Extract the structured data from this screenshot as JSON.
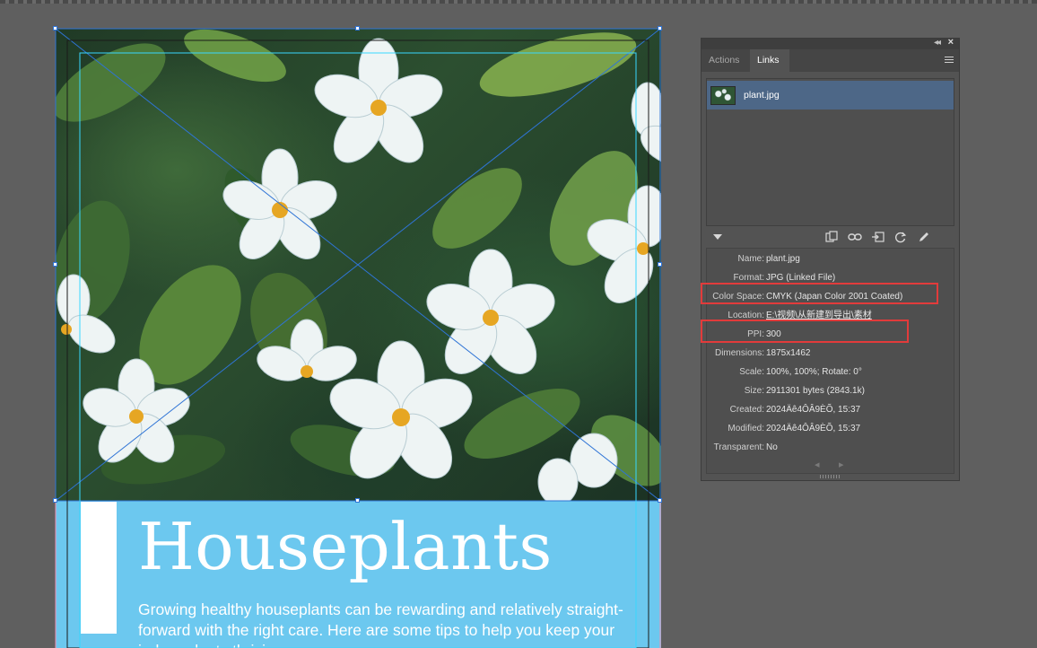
{
  "document": {
    "headline": "Houseplants",
    "body": "Growing healthy houseplants can be rewarding and relatively straight-forward with the right care. Here are some tips to help you keep your indoor plants thriving:"
  },
  "panel": {
    "tabs": [
      {
        "label": "Actions",
        "active": false
      },
      {
        "label": "Links",
        "active": true
      }
    ],
    "links": [
      {
        "name": "plant.jpg",
        "selected": true
      }
    ],
    "info": [
      {
        "label": "Name:",
        "value": "plant.jpg"
      },
      {
        "label": "Format:",
        "value": "JPG (Linked File)"
      },
      {
        "label": "Color Space:",
        "value": "CMYK (Japan Color 2001 Coated)"
      },
      {
        "label": "Location:",
        "value": "E:\\视频\\从新建到导出\\素材"
      },
      {
        "label": "PPI:",
        "value": "300"
      },
      {
        "label": "Dimensions:",
        "value": "1875x1462"
      },
      {
        "label": "Scale:",
        "value": "100%, 100%; Rotate: 0°"
      },
      {
        "label": "Size:",
        "value": "2911301 bytes (2843.1k)"
      },
      {
        "label": "Created:",
        "value": "2024Äê4ÔÂ9ÈÕ, 15:37"
      },
      {
        "label": "Modified:",
        "value": "2024Äê4ÔÂ9ÈÕ, 15:37"
      },
      {
        "label": "Transparent:",
        "value": "No"
      }
    ]
  },
  "colors": {
    "band": "#6cc8ef",
    "selection": "#2f74d6",
    "guide": "#38d7ff",
    "highlight": "#e23b3b",
    "panel_bg": "#535353",
    "selected_row": "#4d6787"
  },
  "icons": [
    "collapse-icon",
    "close-icon",
    "panel-menu-icon",
    "relink-icon",
    "goto-link-icon",
    "embed-icon",
    "update-link-icon",
    "edit-original-icon",
    "prev-icon",
    "next-icon"
  ]
}
